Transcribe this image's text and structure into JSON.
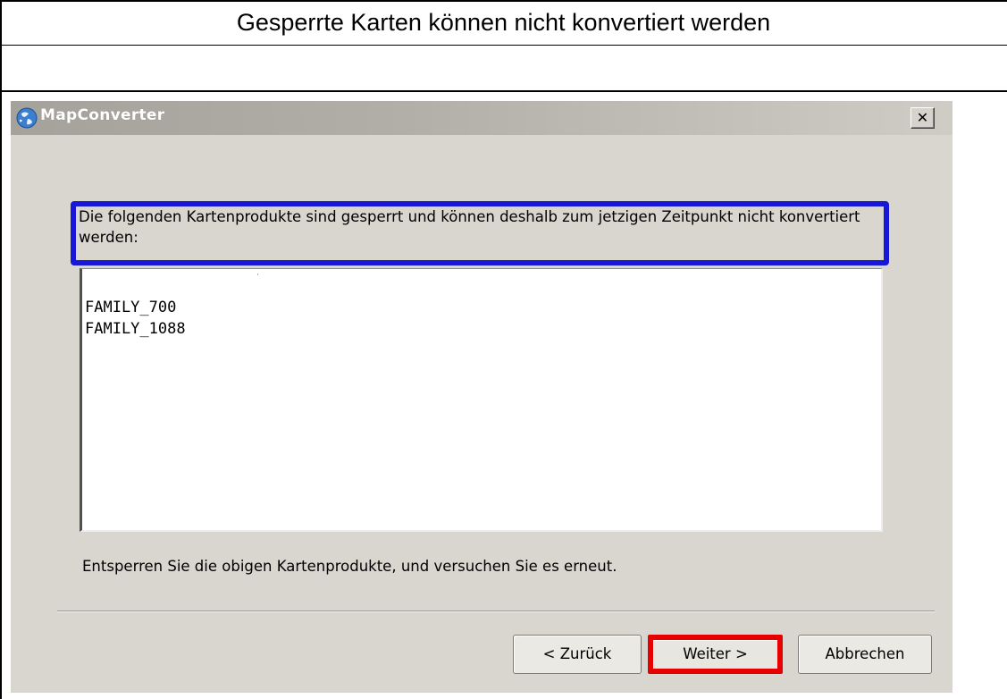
{
  "document": {
    "title": "Gesperrte Karten können nicht konvertiert werden"
  },
  "window": {
    "title": "MapConverter",
    "close_label": "✕"
  },
  "message": {
    "text": "Die folgenden Kartenprodukte sind gesperrt und können deshalb zum jetzigen Zeitpunkt nicht konvertiert werden:"
  },
  "locked_products": {
    "items": [
      "FAMILY_700",
      "FAMILY_1088"
    ]
  },
  "hint": {
    "text": "Entsperren Sie die obigen Kartenprodukte, und versuchen Sie es erneut."
  },
  "buttons": {
    "back": "< Zurück",
    "next": "Weiter >",
    "cancel": "Abbrechen"
  },
  "highlight_colors": {
    "message": "#1717d8",
    "next_button": "#e60000"
  }
}
